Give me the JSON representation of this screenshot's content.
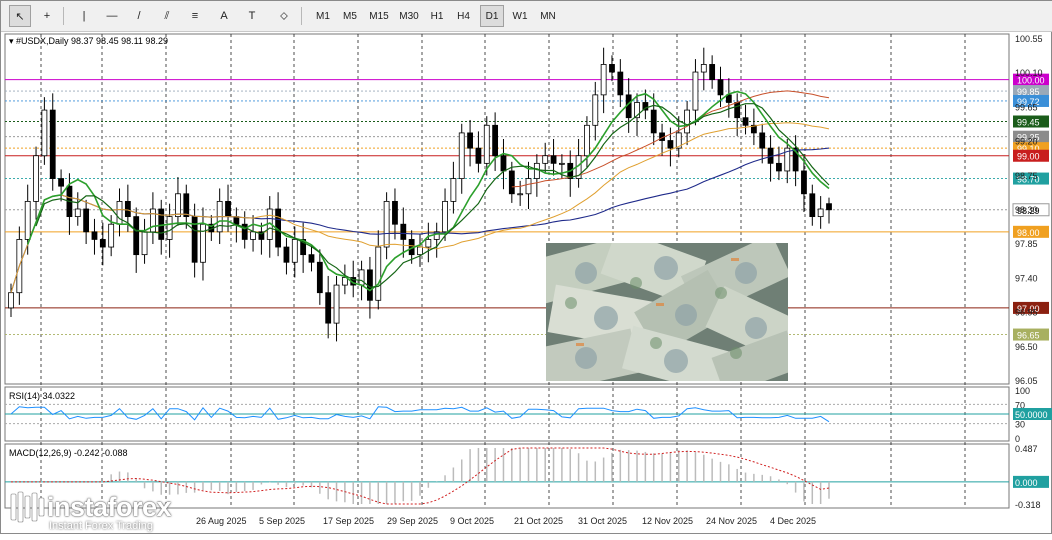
{
  "toolbar": {
    "tools": [
      {
        "name": "cursor-icon",
        "glyph": "↖"
      },
      {
        "name": "crosshair-icon",
        "glyph": "+"
      },
      {
        "name": "vertical-line-icon",
        "glyph": "|"
      },
      {
        "name": "horizontal-line-icon",
        "glyph": "—"
      },
      {
        "name": "trendline-icon",
        "glyph": "/"
      },
      {
        "name": "equidistant-channel-icon",
        "glyph": "⫽"
      },
      {
        "name": "fibonacci-icon",
        "glyph": "≡"
      },
      {
        "name": "text-icon",
        "glyph": "A"
      },
      {
        "name": "text-label-icon",
        "glyph": "T"
      },
      {
        "name": "shapes-icon",
        "glyph": "⬦"
      }
    ],
    "timeframes": [
      "M1",
      "M5",
      "M15",
      "M30",
      "H1",
      "H4",
      "D1",
      "W1",
      "MN"
    ],
    "active_timeframe": "D1"
  },
  "chart": {
    "header": "#USDX,Daily  98.37 98.45 98.11 98.29",
    "price_labels": [
      "100.55",
      "100.10",
      "99.65",
      "99.20",
      "98.75",
      "98.30",
      "97.85",
      "97.40",
      "96.95",
      "96.50",
      "96.05"
    ],
    "level_labels": [
      {
        "text": "100.00",
        "color": "#cc00cc"
      },
      {
        "text": "99.85",
        "color": "#9aa9b8"
      },
      {
        "text": "99.72",
        "color": "#3a8fd8"
      },
      {
        "text": "99.45",
        "color": "#1a5c1a"
      },
      {
        "text": "99.25",
        "color": "#8c8c8c"
      },
      {
        "text": "99.10",
        "color": "#f0a020"
      },
      {
        "text": "99.00",
        "color": "#c81e1e"
      },
      {
        "text": "98.70",
        "color": "#20a0a0"
      },
      {
        "text": "98.29",
        "color": "#ffffff"
      },
      {
        "text": "98.00",
        "color": "#f0a020"
      },
      {
        "text": "97.00",
        "color": "#8b2010"
      },
      {
        "text": "96.65",
        "color": "#a8b060"
      }
    ],
    "date_labels": [
      "26 Aug 2025",
      "5 Sep 2025",
      "17 Sep 2025",
      "29 Sep 2025",
      "9 Oct 2025",
      "21 Oct 2025",
      "31 Oct 2025",
      "12 Nov 2025",
      "24 Nov 2025",
      "4 Dec 2025"
    ],
    "rsi": {
      "header": "RSI(14) 34.0322",
      "scale": [
        "100",
        "70",
        "30",
        "0"
      ],
      "level_label": "50.0000"
    },
    "macd": {
      "header": "MACD(12,26,9) -0.242 -0.088",
      "scale": [
        "0.487",
        "0.000",
        "-0.318"
      ]
    }
  },
  "brand": {
    "name": "instaforex",
    "tagline": "Instant Forex Trading"
  },
  "chart_data": {
    "type": "candlestick",
    "title": "#USDX,Daily",
    "ohlc_last": {
      "open": 98.37,
      "high": 98.45,
      "low": 98.11,
      "close": 98.29
    },
    "y_range": [
      96.0,
      100.6
    ],
    "closes": [
      97.2,
      97.9,
      98.4,
      99.0,
      99.6,
      98.7,
      98.6,
      98.2,
      98.3,
      98.0,
      97.9,
      97.8,
      98.1,
      98.4,
      98.2,
      97.7,
      98.0,
      98.3,
      97.9,
      98.2,
      98.5,
      98.2,
      97.6,
      98.1,
      98.0,
      98.4,
      98.2,
      98.1,
      97.9,
      98.0,
      97.9,
      98.3,
      97.8,
      97.6,
      97.9,
      97.7,
      97.6,
      97.2,
      96.8,
      97.3,
      97.4,
      97.3,
      97.5,
      97.1,
      97.8,
      98.4,
      98.1,
      97.9,
      97.7,
      97.8,
      97.9,
      98.0,
      98.4,
      98.7,
      99.3,
      99.1,
      98.9,
      99.4,
      99.0,
      98.8,
      98.5,
      98.5,
      98.7,
      98.9,
      99.0,
      98.9,
      98.9,
      98.7,
      99.0,
      99.4,
      99.8,
      100.2,
      100.1,
      99.8,
      99.5,
      99.7,
      99.6,
      99.3,
      99.2,
      99.1,
      99.3,
      99.6,
      100.1,
      100.2,
      100.0,
      99.8,
      99.7,
      99.5,
      99.4,
      99.3,
      99.1,
      98.9,
      98.8,
      99.1,
      98.8,
      98.5,
      98.2,
      98.3,
      98.29
    ],
    "levels": [
      100.0,
      99.85,
      99.72,
      99.45,
      99.25,
      99.1,
      99.0,
      98.7,
      98.29,
      98.0,
      97.0,
      96.65
    ],
    "rsi_last": 34.0322,
    "rsi_levels": [
      70,
      50,
      30
    ],
    "macd_last": -0.242,
    "macd_signal_last": -0.088,
    "macd_range": [
      -0.318,
      0.487
    ]
  }
}
